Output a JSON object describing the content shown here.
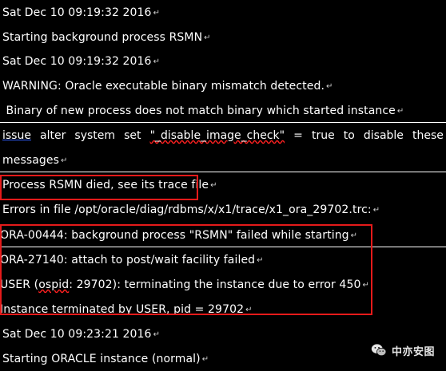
{
  "log": {
    "line1": "Sat Dec 10 09:19:32 2016",
    "line2": "Starting background process RSMN",
    "line3": "Sat Dec 10 09:19:32 2016",
    "line4": "WARNING: Oracle executable binary mismatch detected.",
    "line5": " Binary of new process does not match binary which started instance",
    "line6_words": [
      "issue",
      "alter",
      "system",
      "set",
      "\"_disable_image_check\"",
      "=",
      "true",
      "to",
      "disable",
      "these"
    ],
    "line7": "messages",
    "line8": "Process RSMN died, see its trace file",
    "line9": "Errors in file /opt/oracle/diag/rdbms/x/x1/trace/x1_ora_29702.trc:",
    "line10": "ORA-00444: background process \"RSMN\" failed while starting",
    "line11": "ORA-27140: attach to post/wait facility failed",
    "line12_pre": "USER (",
    "line12_ospid": "ospid",
    "line12_post": ": 29702): terminating the instance due to error 450",
    "line13": "Instance terminated by USER, pid = 29702",
    "line14": "Sat Dec 10 09:23:21 2016",
    "line15": "Starting ORACLE instance (normal)",
    "return_mark": "↵"
  },
  "watermark": {
    "text": "中亦安图",
    "icon": "wechat-icon"
  },
  "colors": {
    "background": "#000000",
    "text": "#ffffff",
    "highlight_box": "#e51a1a"
  }
}
